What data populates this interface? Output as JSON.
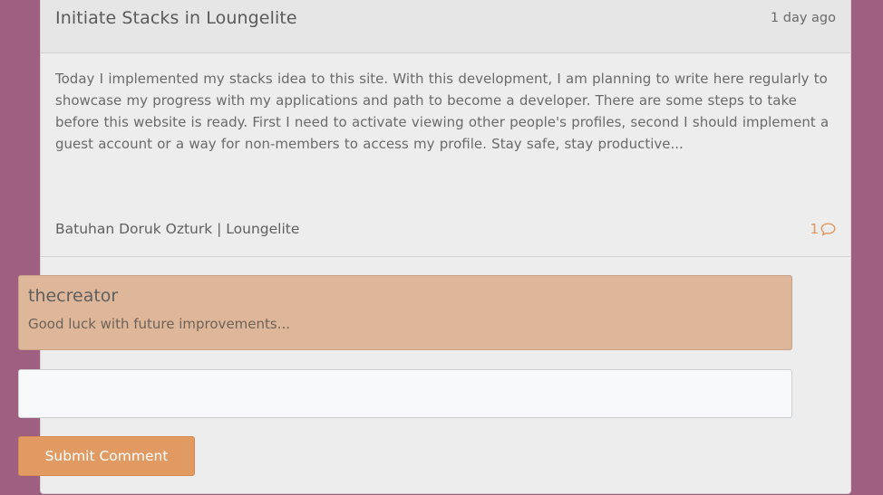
{
  "post": {
    "title": "Initiate Stacks in Loungelite",
    "time": "1 day ago",
    "body": "Today I implemented my stacks idea to this site. With this development, I am planning to write here regularly to showcase my progress with my applications and path to become a developer. There are some steps to take before this website is ready. First I need to activate viewing other people's profiles, second I should implement a guest account or a way for non-members to access my profile. Stay safe, stay productive...",
    "author": "Batuhan Doruk Ozturk | Loungelite",
    "comment_count": "1",
    "comment_icon": "speech-bubble-icon"
  },
  "comments": [
    {
      "user": "thecreator",
      "text": "Good luck with future improvements..."
    }
  ],
  "form": {
    "input_value": "",
    "input_placeholder": "",
    "submit_label": "Submit Comment"
  },
  "colors": {
    "background": "#9e5f80",
    "accent": "#e09a62",
    "comment_bg": "#deb699"
  }
}
